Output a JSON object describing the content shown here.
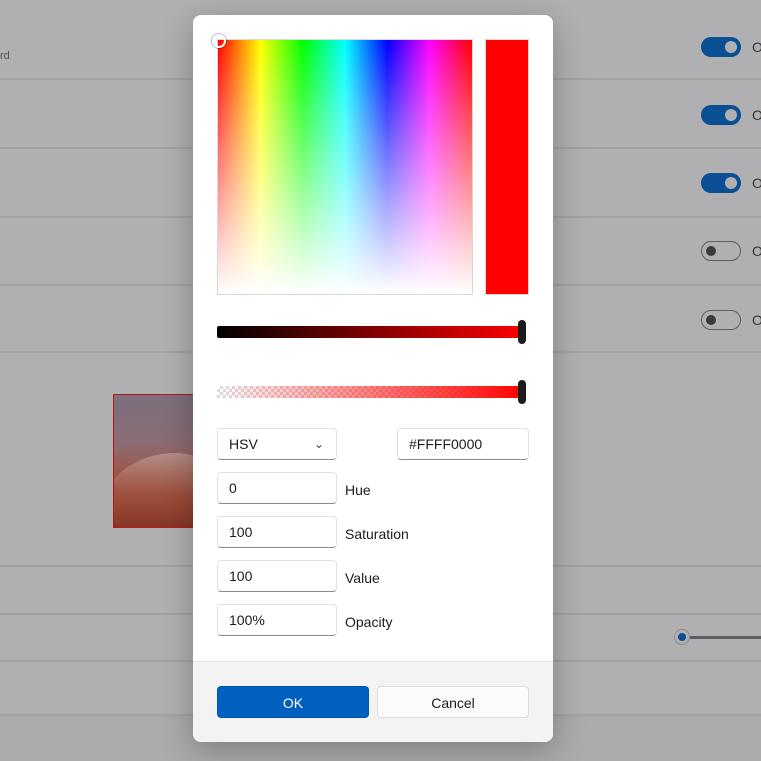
{
  "background": {
    "row1_desc_fragment": "rd",
    "toggles": [
      {
        "state": "on",
        "label_fragment": "O"
      },
      {
        "state": "on",
        "label_fragment": "O"
      },
      {
        "state": "on",
        "label_fragment": "O"
      },
      {
        "state": "off",
        "label_fragment": "O"
      },
      {
        "state": "off",
        "label_fragment": "O"
      }
    ]
  },
  "color_picker": {
    "selected_color": "#FF0000",
    "color_mode": "HSV",
    "hex_value": "#FFFF0000",
    "channels": [
      {
        "value": "0",
        "label": "Hue"
      },
      {
        "value": "100",
        "label": "Saturation"
      },
      {
        "value": "100",
        "label": "Value"
      },
      {
        "value": "100%",
        "label": "Opacity"
      }
    ],
    "value_slider_level": 1.0,
    "opacity_slider_level": 1.0
  },
  "buttons": {
    "ok": "OK",
    "cancel": "Cancel"
  },
  "colors": {
    "accent": "#0060C0",
    "toggle_on": "#0A4E93"
  }
}
